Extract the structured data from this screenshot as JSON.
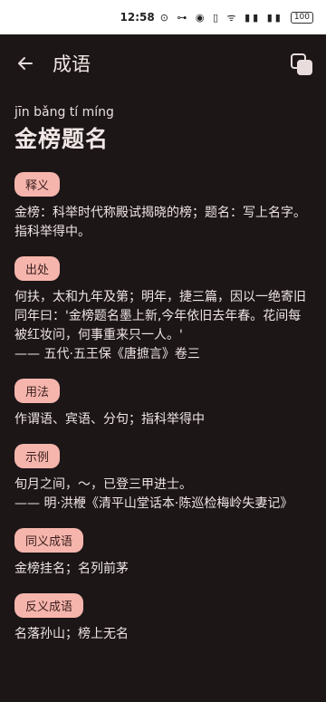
{
  "status": {
    "time": "12:58",
    "icons": "⊙ ⊶ ◉ ▯ ᯤ ▮▮ ▮▮",
    "battery": "100"
  },
  "appbar": {
    "title": "成语"
  },
  "idiom": {
    "pinyin": "jīn bǎng tí míng",
    "text": "金榜题名"
  },
  "sections": {
    "meaning": {
      "label": "释义",
      "text": "金榜：科举时代称殿试揭晓的榜；题名：写上名字。指科举得中。"
    },
    "source": {
      "label": "出处",
      "text": "何扶，太和九年及第；明年，捷三篇，因以一绝寄旧同年曰：'金榜题名墨上新,今年依旧去年春。花间每被红妆问，何事重来只一人。'",
      "attribution": "—— 五代·五王保《唐摭言》卷三"
    },
    "usage": {
      "label": "用法",
      "text": "作谓语、宾语、分句；指科举得中"
    },
    "example": {
      "label": "示例",
      "text": "旬月之间，～，已登三甲进士。",
      "attribution": "—— 明·洪楩《清平山堂话本·陈巡检梅岭失妻记》"
    },
    "synonyms": {
      "label": "同义成语",
      "text": "金榜挂名；名列前茅"
    },
    "antonyms": {
      "label": "反义成语",
      "text": "名落孙山；榜上无名"
    }
  }
}
